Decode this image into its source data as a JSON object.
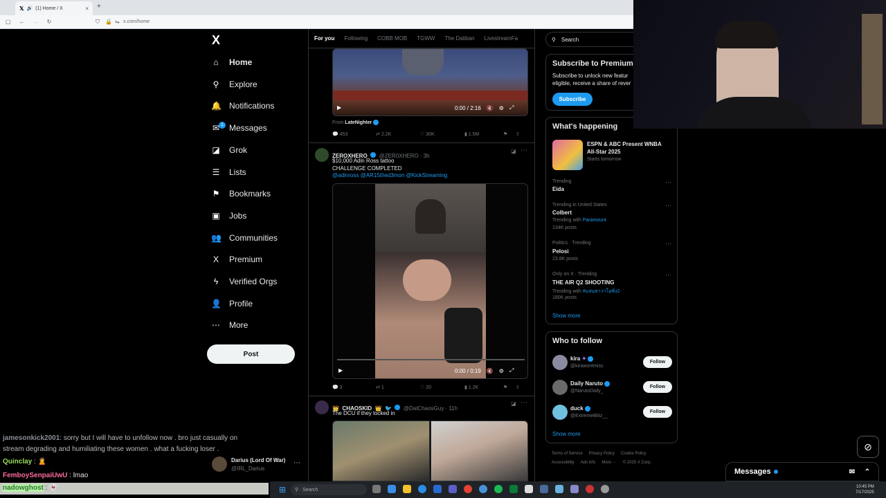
{
  "browser": {
    "tab_title": "(1) Home / X",
    "tab_close": "×",
    "new_tab": "+",
    "url": "x.com/home"
  },
  "nav": {
    "logo": "X",
    "items": [
      {
        "label": "Home",
        "icon": "home-icon",
        "glyph": "⌂"
      },
      {
        "label": "Explore",
        "icon": "search-icon",
        "glyph": "⚲"
      },
      {
        "label": "Notifications",
        "icon": "bell-icon",
        "glyph": "🔔"
      },
      {
        "label": "Messages",
        "icon": "mail-icon",
        "glyph": "✉"
      },
      {
        "label": "Grok",
        "icon": "grok-icon",
        "glyph": "◪"
      },
      {
        "label": "Lists",
        "icon": "list-icon",
        "glyph": "☰"
      },
      {
        "label": "Bookmarks",
        "icon": "bookmark-icon",
        "glyph": "⚑"
      },
      {
        "label": "Jobs",
        "icon": "briefcase-icon",
        "glyph": "▣"
      },
      {
        "label": "Communities",
        "icon": "people-icon",
        "glyph": "👥"
      },
      {
        "label": "Premium",
        "icon": "x-premium-icon",
        "glyph": "X"
      },
      {
        "label": "Verified Orgs",
        "icon": "lightning-icon",
        "glyph": "ϟ"
      },
      {
        "label": "Profile",
        "icon": "person-icon",
        "glyph": "👤"
      },
      {
        "label": "More",
        "icon": "more-circle-icon",
        "glyph": "⋯"
      }
    ],
    "messages_badge": "1",
    "post_label": "Post"
  },
  "account": {
    "name": "Darius (Lord Of War)",
    "handle": "@IRL_Darius"
  },
  "timeline": {
    "tabs": [
      "For you",
      "Following",
      "COBB MOB",
      "TGWW",
      "The Daliban",
      "LivestreamFa"
    ],
    "tweet1": {
      "from_prefix": "From",
      "from_name": "LateNighter",
      "video_time": "0:00 / 2:16",
      "replies": "453",
      "retweets": "2.2K",
      "likes": "30K",
      "views": "1.5M"
    },
    "tweet2": {
      "name": "ZEROXHERO",
      "handle": "@ZER0XHERO · 3h",
      "line1": "$10,000 Adin Ross tattoo",
      "line2": "CHALLENGE COMPLETED",
      "mentions": "@adinross @AR15thed3mon @KickStreaming",
      "video_time": "0:00 / 0:19",
      "replies": "3",
      "retweets": "1",
      "likes": "20",
      "views": "1.2K"
    },
    "tweet3": {
      "name": "CHAOSKID",
      "handle": "@DatChaosGuy · 11h",
      "text": "The DCU if they locked in"
    }
  },
  "right": {
    "search_placeholder": "Search",
    "premium": {
      "title": "Subscribe to Premium",
      "line1": "Subscribe to unlock new featur",
      "line2": "eligible, receive a share of rever",
      "button": "Subscribe"
    },
    "happening": {
      "title": "What's happening",
      "featured_title1": "ESPN & ABC Present WNBA",
      "featured_title2": "All-Star 2025",
      "featured_sub": "Starts tomorrow",
      "trends": [
        {
          "context": "Trending",
          "name": "Eida",
          "extra": ""
        },
        {
          "context": "Trending in United States",
          "name": "Colbert",
          "with_prefix": "Trending with",
          "with": "Paramount",
          "extra": "134K posts"
        },
        {
          "context": "Politics · Trending",
          "name": "Pelosi",
          "extra": "23.8K posts"
        },
        {
          "context": "Only on X · Trending",
          "name": "THE AIR Q2 SHOOTING",
          "with_prefix": "Trending with",
          "with": "#แสนหาวาโอซิ่ง2",
          "extra": "180K posts"
        }
      ],
      "show_more": "Show more"
    },
    "who_to_follow": {
      "title": "Who to follow",
      "users": [
        {
          "name": "kira",
          "handle": "@kirawontmiss",
          "button": "Follow"
        },
        {
          "name": "Daily Naruto",
          "handle": "@NarutoDaily_",
          "button": "Follow"
        },
        {
          "name": "duck",
          "handle": "@ExtremeBlitz__",
          "button": "Follow"
        }
      ],
      "show_more": "Show more"
    },
    "footer": {
      "line1": [
        "Terms of Service",
        "Privacy Policy",
        "Cookie Policy"
      ],
      "line2": [
        "Accessibility",
        "Ads info",
        "More ···",
        "© 2025 X Corp."
      ]
    }
  },
  "messages_drawer": {
    "label": "Messages"
  },
  "chat": [
    {
      "user": "jamesonkick2001",
      "text": ": sorry but I will have to unfollow now . bro just casually on"
    },
    {
      "user": "",
      "text": "stream degrading and humiliating these women . what a fucking loser ."
    },
    {
      "user": "Quinclay",
      "text": " : 🙎"
    },
    {
      "user": "FemboySenpaiUwU",
      "text": " : lmao"
    },
    {
      "user": "nadowghost",
      "text": " : 👻"
    }
  ],
  "taskbar": {
    "search": "Search",
    "time": "10:45 PM",
    "date": "7/17/2025"
  },
  "colors": {
    "accent": "#1d9bf0",
    "background": "#000000",
    "border": "#2f3336",
    "muted": "#71767b"
  }
}
